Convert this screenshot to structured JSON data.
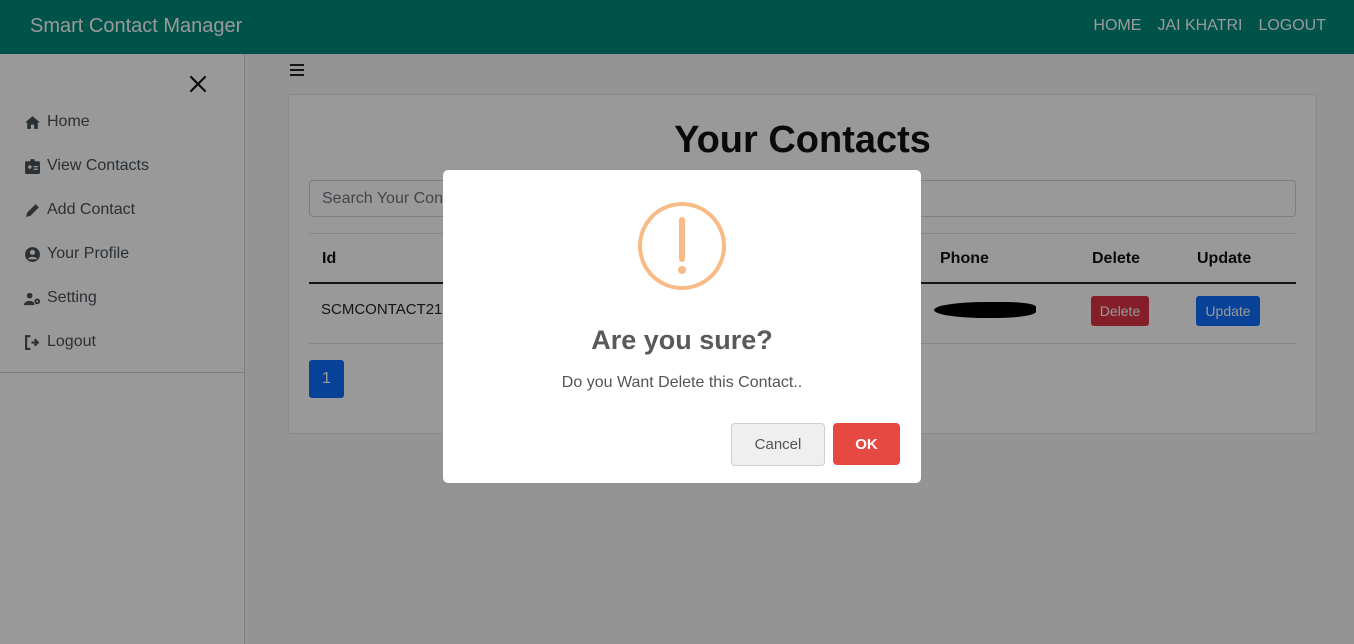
{
  "navbar": {
    "brand": "Smart Contact Manager",
    "links": [
      "HOME",
      "JAI KHATRI",
      "LOGOUT"
    ]
  },
  "sidebar": {
    "items": [
      {
        "label": "Home",
        "icon": "home-icon"
      },
      {
        "label": "View Contacts",
        "icon": "id-badge-icon"
      },
      {
        "label": "Add Contact",
        "icon": "pencil-icon"
      },
      {
        "label": "Your Profile",
        "icon": "user-circle-icon"
      },
      {
        "label": "Setting",
        "icon": "user-cog-icon"
      },
      {
        "label": "Logout",
        "icon": "sign-out-icon"
      }
    ]
  },
  "main": {
    "title": "Your Contacts",
    "search_placeholder": "Search Your Contacts",
    "table": {
      "headers": [
        "Id",
        "Phone",
        "Delete",
        "Update"
      ],
      "rows": [
        {
          "id": "SCMCONTACT21",
          "delete": "Delete",
          "update": "Update"
        }
      ]
    },
    "pagination": [
      "1"
    ]
  },
  "dialog": {
    "title": "Are you sure?",
    "text": "Do you Want Delete this Contact..",
    "cancel": "Cancel",
    "ok": "OK"
  },
  "colors": {
    "navbar": "#008b7b",
    "danger": "#dc3545",
    "primary": "#0d6efd",
    "warning_icon": "#f8bb86",
    "ok_button": "#e64942"
  }
}
